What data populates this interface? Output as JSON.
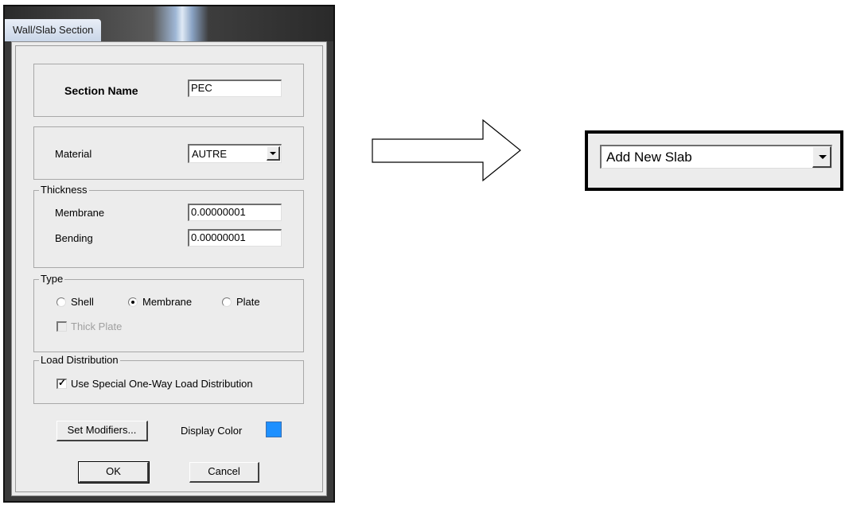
{
  "dialog": {
    "title": "Wall/Slab Section",
    "section_name": {
      "label": "Section Name",
      "value": "PEC"
    },
    "material": {
      "label": "Material",
      "value": "AUTRE"
    },
    "thickness": {
      "legend": "Thickness",
      "membrane": {
        "label": "Membrane",
        "value": "0.00000001"
      },
      "bending": {
        "label": "Bending",
        "value": "0.00000001"
      }
    },
    "type": {
      "legend": "Type",
      "options": [
        "Shell",
        "Membrane",
        "Plate"
      ],
      "selected": "Membrane",
      "thick_plate": {
        "label": "Thick Plate",
        "checked": false,
        "enabled": false
      }
    },
    "load_distribution": {
      "legend": "Load Distribution",
      "use_special": {
        "label": "Use Special One-Way Load Distribution",
        "checked": true
      }
    },
    "set_modifiers_label": "Set Modifiers...",
    "display_color": {
      "label": "Display Color",
      "color": "#1e90ff"
    },
    "ok_label": "OK",
    "cancel_label": "Cancel"
  },
  "arrow_icon": "right-arrow",
  "snippet": {
    "dropdown_value": "Add New Slab"
  }
}
